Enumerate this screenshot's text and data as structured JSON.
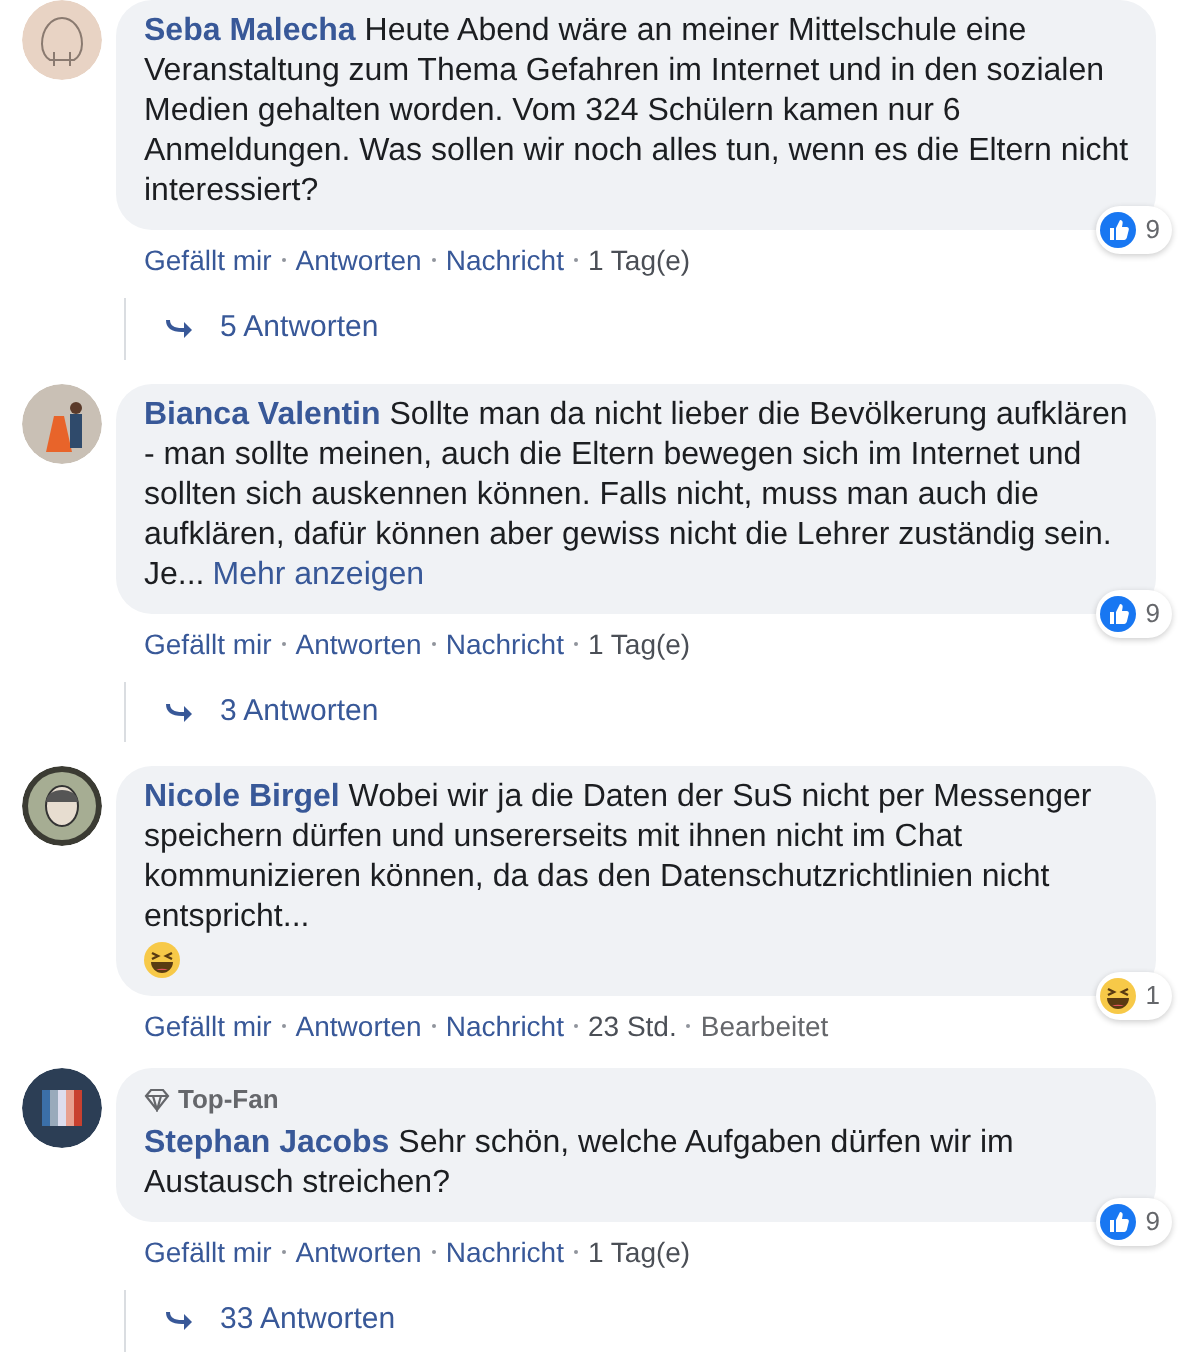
{
  "comments": [
    {
      "avatar": {
        "kind": "walrus"
      },
      "author": "Seba Malecha",
      "text": "Heute Abend wäre an meiner Mittelschule eine Veranstaltung zum Thema Gefahren im Internet und in den sozialen Medien gehalten worden. Vom 324 Schülern kamen nur 6 Anmeldungen. Was sollen wir noch alles tun, wenn es die Eltern nicht interessiert?",
      "actions": [
        "Gefällt mir",
        "Antworten",
        "Nachricht"
      ],
      "time": "1 Tag(e)",
      "reaction": {
        "kind": "like",
        "count": "9"
      },
      "replies": "5 Antworten"
    },
    {
      "avatar": {
        "kind": "person"
      },
      "author": "Bianca Valentin",
      "text": "Sollte man da nicht lieber die Bevölkerung aufklären - man sollte meinen, auch die Eltern bewegen sich im Internet und sollten sich auskennen können. Falls nicht, muss man auch die aufklären, dafür können aber gewiss nicht die Lehrer zuständig sein.",
      "more": {
        "prefix": "Je...",
        "link": "Mehr anzeigen"
      },
      "actions": [
        "Gefällt mir",
        "Antworten",
        "Nachricht"
      ],
      "time": "1 Tag(e)",
      "reaction": {
        "kind": "like",
        "count": "9"
      },
      "replies": "3 Antworten"
    },
    {
      "avatar": {
        "kind": "cartoon"
      },
      "author": "Nicole Birgel",
      "text": "Wobei wir ja die Daten der SuS nicht per Messenger speichern dürfen und unsererseits mit ihnen nicht im Chat kommunizieren können, da das den Datenschutzrichtlinien nicht entspricht...",
      "inline_emoji": {
        "kind": "haha"
      },
      "actions": [
        "Gefällt mir",
        "Antworten",
        "Nachricht"
      ],
      "time": "23 Std.",
      "edited": "Bearbeitet",
      "reaction": {
        "kind": "haha",
        "count": "1"
      }
    },
    {
      "avatar": {
        "kind": "logo"
      },
      "badge": "Top-Fan",
      "author": "Stephan Jacobs",
      "text": "Sehr schön, welche Aufgaben dürfen wir im Austausch streichen?",
      "actions": [
        "Gefällt mir",
        "Antworten",
        "Nachricht"
      ],
      "time": "1 Tag(e)",
      "reaction": {
        "kind": "like",
        "count": "9"
      },
      "replies": "33 Antworten"
    }
  ]
}
